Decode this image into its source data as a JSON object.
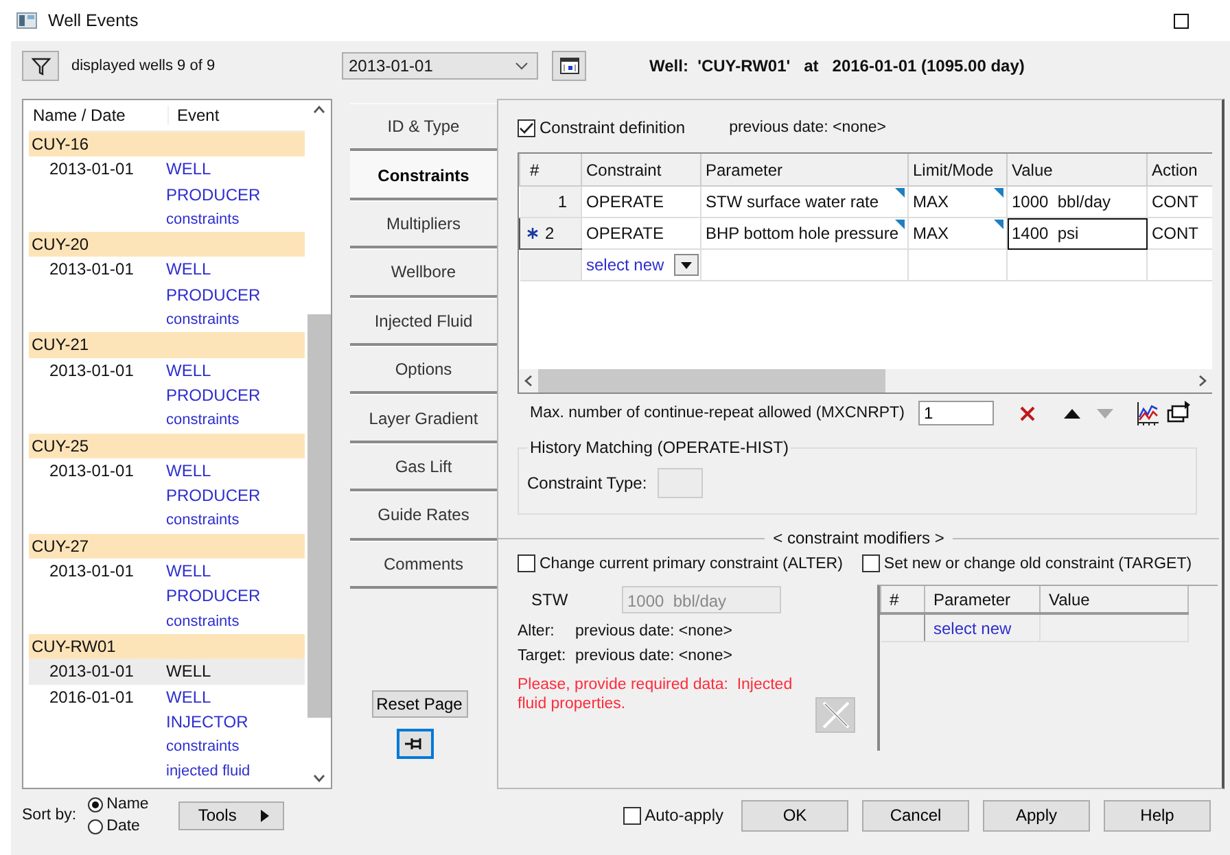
{
  "window": {
    "title": "Well Events"
  },
  "filter": {
    "label": "displayed wells 9 of 9"
  },
  "date_select": {
    "value": "2013-01-01"
  },
  "heading": "Well:  'CUY-RW01'   at   2016-01-01 (1095.00 day)",
  "well_list": {
    "columns": [
      "Name / Date",
      "Event"
    ],
    "wells": [
      {
        "name": "CUY-16",
        "children": [
          {
            "date": "2013-01-01",
            "selected": false,
            "events": [
              "WELL",
              "PRODUCER",
              "constraints"
            ]
          }
        ]
      },
      {
        "name": "CUY-20",
        "children": [
          {
            "date": "2013-01-01",
            "selected": false,
            "events": [
              "WELL",
              "PRODUCER",
              "constraints"
            ]
          }
        ]
      },
      {
        "name": "CUY-21",
        "children": [
          {
            "date": "2013-01-01",
            "selected": false,
            "events": [
              "WELL",
              "PRODUCER",
              "constraints"
            ]
          }
        ]
      },
      {
        "name": "CUY-25",
        "children": [
          {
            "date": "2013-01-01",
            "selected": false,
            "events": [
              "WELL",
              "PRODUCER",
              "constraints"
            ]
          }
        ]
      },
      {
        "name": "CUY-27",
        "children": [
          {
            "date": "2013-01-01",
            "selected": false,
            "events": [
              "WELL",
              "PRODUCER",
              "constraints"
            ]
          }
        ]
      },
      {
        "name": "CUY-RW01",
        "children": [
          {
            "date": "2013-01-01",
            "selected": true,
            "events": [
              "WELL"
            ]
          },
          {
            "date": "2016-01-01",
            "selected": false,
            "events": [
              "WELL",
              "INJECTOR",
              "constraints",
              "injected fluid"
            ]
          }
        ]
      }
    ]
  },
  "tabs": [
    {
      "label": "ID & Type",
      "selected": false
    },
    {
      "label": "Constraints",
      "selected": true
    },
    {
      "label": "Multipliers",
      "selected": false
    },
    {
      "label": "Wellbore",
      "selected": false
    },
    {
      "label": "Injected Fluid",
      "selected": false
    },
    {
      "label": "Options",
      "selected": false
    },
    {
      "label": "Layer Gradient",
      "selected": false
    },
    {
      "label": "Gas Lift",
      "selected": false
    },
    {
      "label": "Guide Rates",
      "selected": false
    },
    {
      "label": "Comments",
      "selected": false
    }
  ],
  "reset_button": "Reset Page",
  "constraint_definition": {
    "label": "Constraint definition",
    "checked": true,
    "previous": "previous date: <none>"
  },
  "constraints_table": {
    "columns": [
      "#",
      "Constraint",
      "Parameter",
      "Limit/Mode",
      "Value",
      "Action"
    ],
    "rows": [
      {
        "number": "1",
        "current": false,
        "constraint": "OPERATE",
        "parameter": "STW surface water rate",
        "limit": "MAX",
        "value": "1000  bbl/day",
        "focused": false,
        "action": "CONT"
      },
      {
        "number": "2",
        "current": true,
        "constraint": "OPERATE",
        "parameter": "BHP bottom hole pressure",
        "limit": "MAX",
        "value": "1400  psi",
        "focused": true,
        "action": "CONT"
      }
    ],
    "new_row": "select new"
  },
  "mxcnrpt": {
    "label": "Max. number of continue-repeat allowed (MXCNRPT)",
    "value": "1"
  },
  "history": {
    "title": "History Matching (OPERATE-HIST)",
    "label": "Constraint Type:"
  },
  "modifiers": {
    "title": "< constraint modifiers >",
    "alter": {
      "label": "Change current primary constraint (ALTER)",
      "checked": false
    },
    "target": {
      "label": "Set new or change old constraint (TARGET)",
      "checked": false
    },
    "stw_label": "STW",
    "stw_value": "1000  bbl/day",
    "alter_info": {
      "label": "Alter:",
      "text": "previous date: <none>"
    },
    "target_info": {
      "label": "Target:",
      "text": "previous date: <none>"
    },
    "warning": "Please, provide required data:  Injected fluid properties.",
    "table": {
      "columns": [
        "#",
        "Parameter",
        "Value"
      ],
      "new_row": "select new"
    }
  },
  "sort": {
    "label": "Sort by:",
    "options": [
      {
        "label": "Name",
        "selected": true
      },
      {
        "label": "Date",
        "selected": false
      }
    ]
  },
  "tools_button": "Tools",
  "auto_apply": {
    "label": "Auto-apply",
    "checked": false
  },
  "buttons": [
    "OK",
    "Cancel",
    "Apply",
    "Help"
  ]
}
